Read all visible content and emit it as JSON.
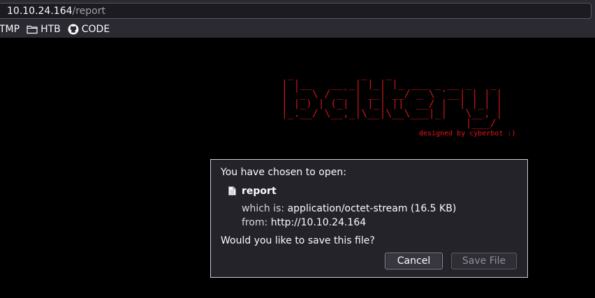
{
  "browser": {
    "url_host": "10.10.24.164",
    "url_path": "/report",
    "bookmarks": [
      {
        "label": "TMP",
        "icon": "none"
      },
      {
        "label": "HTB",
        "icon": "folder-icon"
      },
      {
        "label": "CODE",
        "icon": "github-icon"
      }
    ]
  },
  "page": {
    "ascii_logo": " _           _   _                       \n| |__   __ _| |_| |_ ___ _ __ _   _     \n| '_ \\ / _` | __| __/ _ \\ '__| | | |   \n| |_) | (_| | |_| ||  __/ |  | |_| |   \n|_.__/ \\__,_|\\__|\\__\\___|_|   \\__, |  \n                              |___/   ",
    "credit": "designed by cyberbot :)",
    "logo_color": "#c8171a"
  },
  "dialog": {
    "title": "You have chosen to open:",
    "file_name": "report",
    "type_label": "which is:",
    "type_value": "application/octet-stream (16.5 KB)",
    "from_label": "from:",
    "from_value": "http://10.10.24.164",
    "question": "Would you like to save this file?",
    "cancel_label": "Cancel",
    "save_label": "Save File"
  }
}
